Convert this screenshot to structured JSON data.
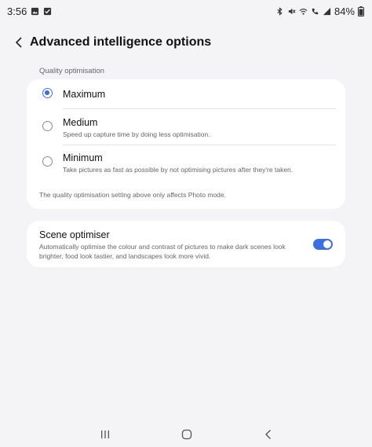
{
  "status_bar": {
    "time": "3:56",
    "battery": "84%",
    "icons": [
      "gallery-icon",
      "check-icon",
      "bluetooth-icon",
      "mute-icon",
      "wifi-icon",
      "call-icon",
      "signal-icon",
      "battery-icon"
    ]
  },
  "header": {
    "title": "Advanced intelligence options",
    "back_icon": "back-arrow-icon"
  },
  "quality": {
    "section_label": "Quality optimisation",
    "options": [
      {
        "label": "Maximum",
        "description": "",
        "selected": true
      },
      {
        "label": "Medium",
        "description": "Speed up capture time by doing less optimisation.",
        "selected": false
      },
      {
        "label": "Minimum",
        "description": "Take pictures as fast as possible by not optimising pictures after they're taken.",
        "selected": false
      }
    ],
    "note": "The quality optimisation setting above only affects Photo mode."
  },
  "scene_optimiser": {
    "title": "Scene optimiser",
    "description": "Automatically optimise the colour and contrast of pictures to make dark scenes look brighter, food look tastier, and landscapes look more vivid.",
    "enabled": true
  },
  "nav_bar": {
    "icons": [
      "recents-icon",
      "home-icon",
      "back-icon"
    ]
  },
  "colors": {
    "accent": "#3e6fe0",
    "background": "#f4f4f6",
    "card": "#ffffff"
  }
}
